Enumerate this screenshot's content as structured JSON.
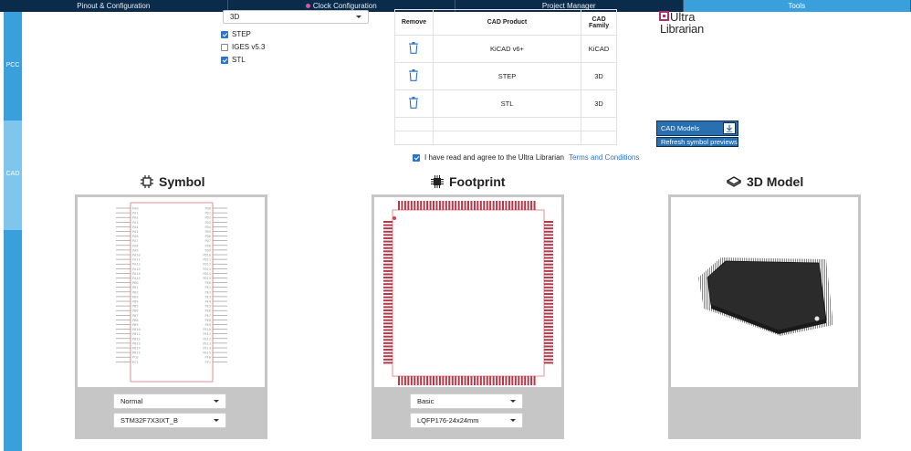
{
  "topbar": {
    "tabs": [
      {
        "label": "Pinout & Configuration",
        "active": false
      },
      {
        "label": "Clock Configuration",
        "active": false,
        "dot": true
      },
      {
        "label": "Project Manager",
        "active": false
      },
      {
        "label": "Tools",
        "active": true
      }
    ]
  },
  "leftrail": {
    "pcc": "PCC",
    "cad": "CAD"
  },
  "options": {
    "format_value": "3D",
    "checkboxes": [
      {
        "label": "STEP",
        "checked": true
      },
      {
        "label": "IGES v5.3",
        "checked": false
      },
      {
        "label": "STL",
        "checked": true
      }
    ]
  },
  "cad_table": {
    "headers": [
      "Remove",
      "CAD Product",
      "CAD Family"
    ],
    "rows": [
      {
        "product": "KiCAD v6+",
        "family": "KiCAD"
      },
      {
        "product": "STEP",
        "family": "3D"
      },
      {
        "product": "STL",
        "family": "3D"
      }
    ]
  },
  "agree": {
    "text": "I have read and agree to the Ultra Librarian",
    "link": "Terms and Conditions",
    "checked": true
  },
  "logo": {
    "line1": "Ultra",
    "line2": "Librarian"
  },
  "buttons": {
    "cad_models": "CAD Models",
    "refresh": "Refresh symbol previews"
  },
  "sections": {
    "symbol": {
      "title": "Symbol",
      "dropdown1": "Normal",
      "dropdown2": "STM32F7X3IXT_B",
      "left_pins": [
        "PA0",
        "PA1",
        "PA2",
        "PA3",
        "PA4",
        "PA5",
        "PA6",
        "PA7",
        "PA8",
        "PA9",
        "PA10",
        "PA11",
        "PA12",
        "PA13",
        "PA14",
        "PA15",
        "PB0",
        "PB1",
        "PB2",
        "PB3",
        "PB4",
        "PB5",
        "PB6",
        "PB7",
        "PB8",
        "PB9",
        "PB10",
        "PB11",
        "PB12",
        "PB13",
        "PB14",
        "PB15",
        "PC0",
        "PC1"
      ],
      "right_pins": [
        "PD0",
        "PD1",
        "PD2",
        "PD3",
        "PD4",
        "PD5",
        "PD6",
        "PD7",
        "PD8",
        "PD9",
        "PD10",
        "PD11",
        "PD12",
        "PD13",
        "PD14",
        "PD15",
        "PE0",
        "PE1",
        "PE2",
        "PE3",
        "PE4",
        "PE5",
        "PE6",
        "PE7",
        "PE8",
        "PE9",
        "PE10",
        "PE11",
        "PE12",
        "PE13",
        "PE14",
        "PE15",
        "PF0",
        "PF1"
      ]
    },
    "footprint": {
      "title": "Footprint",
      "dropdown1": "Basic",
      "dropdown2": "LQFP176-24x24mm"
    },
    "model3d": {
      "title": "3D Model"
    }
  },
  "colors": {
    "accent": "#3aa0dc",
    "topbar": "#0b2b4b",
    "trash": "#2a74c9",
    "pad": "#b03a4a",
    "button": "#2a6fb0"
  }
}
